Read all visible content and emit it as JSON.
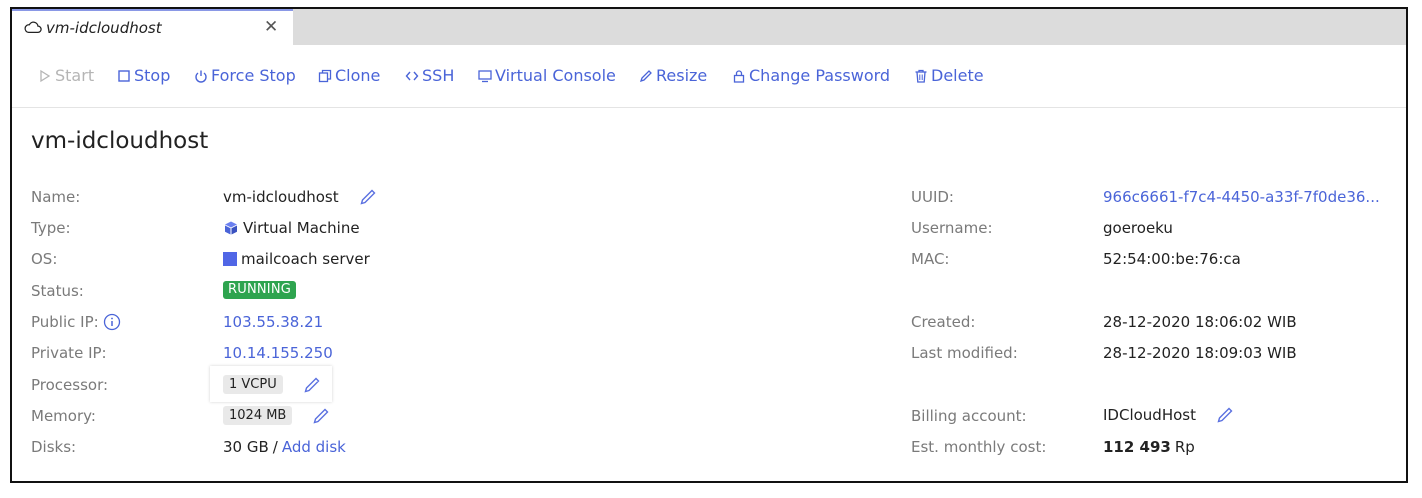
{
  "tab": {
    "title": "vm-idcloudhost",
    "close": "✕"
  },
  "toolbar": {
    "start": "Start",
    "stop": "Stop",
    "force_stop": "Force Stop",
    "clone": "Clone",
    "ssh": "SSH",
    "virtual_console": "Virtual Console",
    "resize": "Resize",
    "change_password": "Change Password",
    "delete": "Delete"
  },
  "vm": {
    "title": "vm-idcloudhost",
    "labels": {
      "name": "Name:",
      "type": "Type:",
      "os": "OS:",
      "status": "Status:",
      "public_ip": "Public IP:",
      "private_ip": "Private IP:",
      "processor": "Processor:",
      "memory": "Memory:",
      "disks": "Disks:",
      "uuid": "UUID:",
      "username": "Username:",
      "mac": "MAC:",
      "created": "Created:",
      "last_modified": "Last modified:",
      "billing_account": "Billing account:",
      "est_monthly_cost": "Est. monthly cost:"
    },
    "values": {
      "name": "vm-idcloudhost",
      "type": "Virtual Machine",
      "os": "mailcoach server",
      "status": "RUNNING",
      "public_ip": "103.55.38.21",
      "private_ip": "10.14.155.250",
      "processor": "1 VCPU",
      "memory": "1024 MB",
      "disks_size": "30 GB",
      "disks_sep": "/",
      "add_disk": "Add disk",
      "uuid": "966c6661-f7c4-4450-a33f-7f0de36...",
      "username": "goeroeku",
      "mac": "52:54:00:be:76:ca",
      "created": "28-12-2020 18:06:02 WIB",
      "last_modified": "28-12-2020 18:09:03 WIB",
      "billing_account": "IDCloudHost",
      "cost_amount": "112 493",
      "cost_currency": "Rp"
    }
  },
  "colors": {
    "link": "#4a64d8",
    "running": "#2ea44f",
    "label": "#7a7a7a",
    "tab_accent": "#8a98e6"
  },
  "icons": [
    "cloud-icon",
    "close-icon",
    "play-icon",
    "stop-icon",
    "power-icon",
    "clone-icon",
    "code-icon",
    "monitor-icon",
    "pencil-icon",
    "lock-icon",
    "trash-icon",
    "cube-icon",
    "info-icon"
  ]
}
